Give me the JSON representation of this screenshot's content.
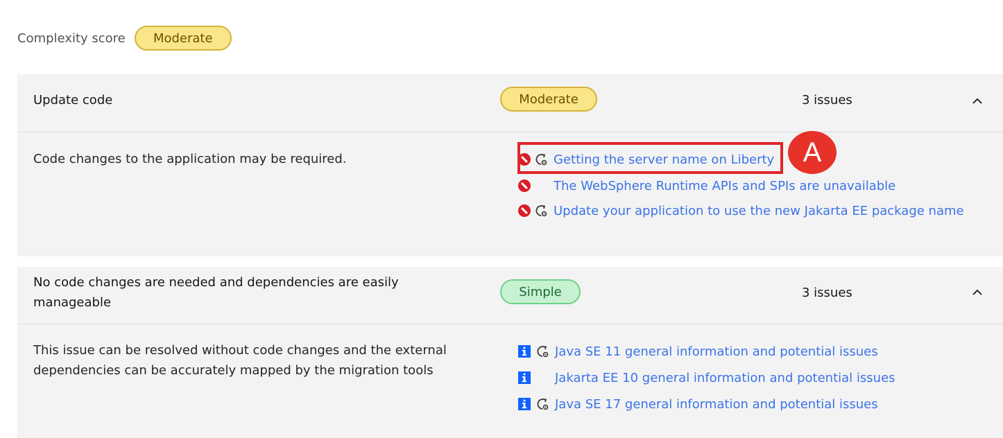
{
  "complexity": {
    "label": "Complexity score",
    "value": "Moderate"
  },
  "groups": [
    {
      "title": "Update code",
      "tag": "Moderate",
      "count": "3 issues",
      "description": "Code changes to the application may be required.",
      "issues": [
        {
          "label": "Getting the server name on Liberty",
          "icons": [
            "blocked-icon",
            "automation-icon"
          ]
        },
        {
          "label": "The WebSphere Runtime APIs and SPIs are unavailable",
          "icons": [
            "blocked-icon"
          ]
        },
        {
          "label": "Update your application to use the new Jakarta EE package name",
          "icons": [
            "blocked-icon",
            "automation-icon"
          ]
        }
      ]
    },
    {
      "title": "No code changes are needed and dependencies are easily manageable",
      "tag": "Simple",
      "count": "3 issues",
      "description": "This issue can be resolved without code changes and the external dependencies can be accurately mapped by the migration tools",
      "issues": [
        {
          "label": "Java SE 11 general information and potential issues",
          "icons": [
            "info-icon",
            "automation-icon"
          ]
        },
        {
          "label": "Jakarta EE 10 general information and potential issues",
          "icons": [
            "info-icon"
          ]
        },
        {
          "label": "Java SE 17 general information and potential issues",
          "icons": [
            "info-icon",
            "automation-icon"
          ]
        }
      ]
    }
  ],
  "callout": {
    "letter": "A"
  },
  "colors": {
    "link": "#3b73e8",
    "blocked": "#da1e28",
    "info": "#0f62fe",
    "callout": "#e63228"
  }
}
